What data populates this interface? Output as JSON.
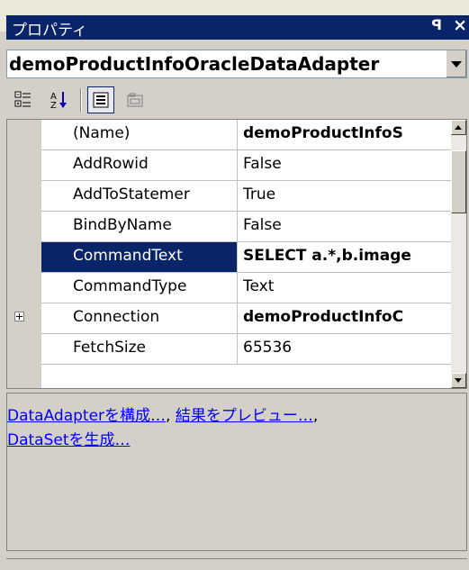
{
  "window": {
    "title": "プロパティ",
    "pin_icon": "pushpin-icon",
    "close_icon": "close-icon"
  },
  "object_selector": {
    "selected": "demoProductInfoOracleDataAdapter"
  },
  "toolbar": {
    "buttons": [
      {
        "name": "categorized-button",
        "icon": "categorized-icon",
        "active": false
      },
      {
        "name": "alphabetical-button",
        "icon": "sort-az-icon",
        "active": false
      },
      {
        "name": "properties-button",
        "icon": "properties-icon",
        "active": true
      },
      {
        "name": "property-pages-button",
        "icon": "property-pages-icon",
        "active": false
      }
    ]
  },
  "properties": [
    {
      "name": "(Name)",
      "value": "demoProductInfoS",
      "bold": true,
      "expandable": false,
      "selected": false
    },
    {
      "name": "AddRowid",
      "value": "False",
      "bold": false,
      "expandable": false,
      "selected": false
    },
    {
      "name": "AddToStatemer",
      "value": "True",
      "bold": false,
      "expandable": false,
      "selected": false
    },
    {
      "name": "BindByName",
      "value": "False",
      "bold": false,
      "expandable": false,
      "selected": false
    },
    {
      "name": "CommandText",
      "value": "SELECT a.*,b.image",
      "bold": true,
      "expandable": false,
      "selected": true
    },
    {
      "name": "CommandType",
      "value": "Text",
      "bold": false,
      "expandable": false,
      "selected": false
    },
    {
      "name": "Connection",
      "value": "demoProductInfoC",
      "bold": true,
      "expandable": true,
      "selected": false
    },
    {
      "name": "FetchSize",
      "value": "65536",
      "bold": false,
      "expandable": false,
      "selected": false
    }
  ],
  "commands": {
    "configure": "DataAdapterを構成…",
    "separator": ", ",
    "preview": "結果をプレビュー…",
    "tail": ",",
    "generate": "DataSetを生成…"
  },
  "colors": {
    "selection": "#0a246a",
    "link": "#0000ff"
  }
}
